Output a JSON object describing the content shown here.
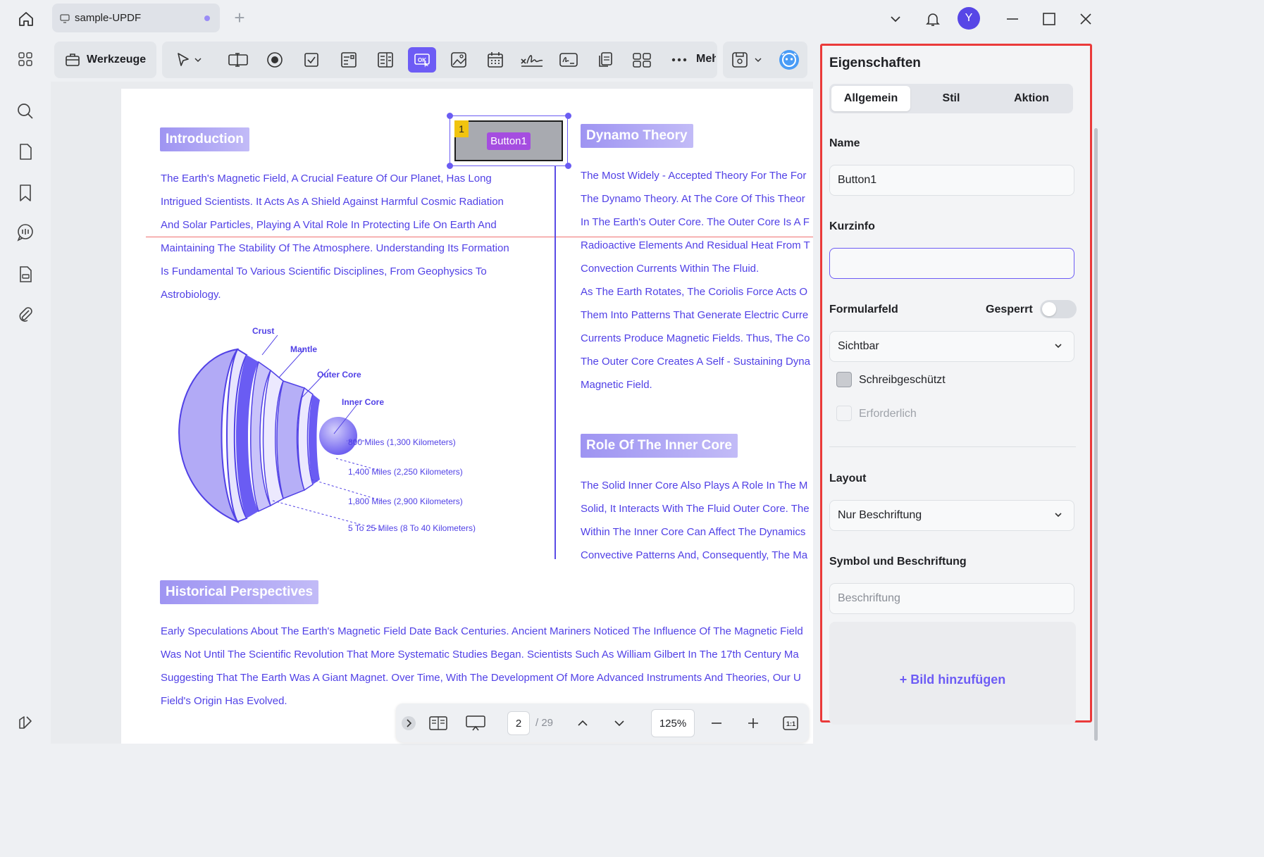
{
  "titlebar": {
    "tab_title": "sample-UPDF",
    "avatar_initial": "Y"
  },
  "toolbar": {
    "tools_label": "Werkzeuge",
    "more_label": "Mehr"
  },
  "document": {
    "button_field": {
      "label": "Button1",
      "number": "1"
    },
    "sections": {
      "introduction": {
        "heading": "Introduction",
        "lines": [
          "The Earth's Magnetic Field, A Crucial Feature Of Our Planet, Has Long",
          "Intrigued Scientists. It Acts As A Shield Against Harmful Cosmic Radiation",
          "And Solar Particles, Playing A Vital Role In Protecting Life On Earth And",
          "Maintaining The Stability Of The Atmosphere. Understanding Its Formation",
          "Is Fundamental To Various Scientific Disciplines, From Geophysics To",
          "Astrobiology."
        ]
      },
      "dynamo": {
        "heading": "Dynamo Theory",
        "lines": [
          "The Most Widely - Accepted Theory For The For",
          "The Dynamo Theory. At The Core Of This Theor",
          "In The Earth's Outer Core. The Outer Core Is A F",
          "Radioactive Elements And Residual Heat From T",
          "Convection Currents Within The Fluid.",
          "As The Earth Rotates, The Coriolis Force Acts O",
          "Them Into Patterns That Generate Electric Curre",
          "Currents Produce Magnetic Fields. Thus, The Co",
          "The Outer Core Creates A Self - Sustaining Dyna",
          "Magnetic Field."
        ]
      },
      "inner_core": {
        "heading": "Role Of The Inner Core",
        "lines": [
          "The Solid Inner Core Also Plays A Role In The M",
          "Solid, It Interacts With The Fluid Outer Core. The",
          "Within The Inner Core Can Affect The Dynamics",
          "Convective Patterns And, Consequently, The Ma"
        ]
      },
      "historical": {
        "heading": "Historical Perspectives",
        "lines": [
          "Early Speculations About The Earth's Magnetic Field Date Back Centuries. Ancient Mariners Noticed The Influence Of The Magnetic Field",
          "Was Not Until The Scientific Revolution That More Systematic Studies Began. Scientists Such As William Gilbert In The 17th Century Ma",
          "Suggesting That The Earth Was A Giant Magnet. Over Time, With The Development Of More Advanced Instruments And Theories, Our U",
          "Field's Origin Has Evolved."
        ]
      }
    },
    "diagram": {
      "layers": [
        "Crust",
        "Mantle",
        "Outer Core",
        "Inner Core"
      ],
      "depths": [
        "800 Miles (1,300 Kilometers)",
        "1,400 Miles (2,250 Kilometers)",
        "1,800 Miles (2,900 Kilometers)",
        "5 To 25 Miles (8 To 40 Kilometers)"
      ]
    }
  },
  "bottom_nav": {
    "current_page": "2",
    "total_pages": "/ 29",
    "zoom": "125%"
  },
  "panel": {
    "title": "Eigenschaften",
    "tabs": [
      "Allgemein",
      "Stil",
      "Aktion"
    ],
    "active_tab": "Allgemein",
    "name_label": "Name",
    "name_value": "Button1",
    "tooltip_label": "Kurzinfo",
    "tooltip_value": "",
    "form_field_label": "Formularfeld",
    "locked_label": "Gesperrt",
    "visibility_value": "Sichtbar",
    "readonly_label": "Schreibgeschützt",
    "required_label": "Erforderlich",
    "layout_label": "Layout",
    "layout_value": "Nur Beschriftung",
    "icon_caption_label": "Symbol und Beschriftung",
    "caption_placeholder": "Beschriftung",
    "add_image_label": "+ Bild hinzufügen"
  },
  "colors": {
    "accent": "#6d5cf5",
    "doc_text": "#5141e6",
    "highlight_border": "#ea3a3a"
  }
}
